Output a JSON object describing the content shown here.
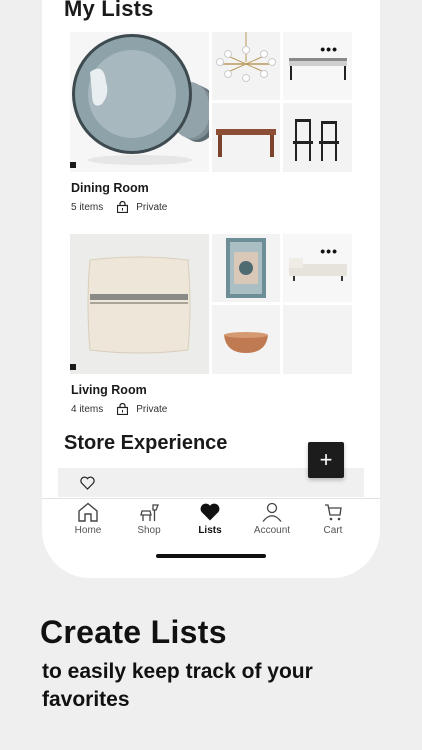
{
  "lists_heading": "My Lists",
  "lists": [
    {
      "title": "Dining Room",
      "count": "5 items",
      "privacy": "Private",
      "more": "•••"
    },
    {
      "title": "Living Room",
      "count": "4 items",
      "privacy": "Private",
      "more": "•••"
    }
  ],
  "store_section": {
    "title": "Store Experience",
    "add_label": "+"
  },
  "tabs": [
    {
      "label": "Home",
      "icon": "home-icon"
    },
    {
      "label": "Shop",
      "icon": "shop-icon"
    },
    {
      "label": "Lists",
      "icon": "heart-icon",
      "active": true
    },
    {
      "label": "Account",
      "icon": "account-icon"
    },
    {
      "label": "Cart",
      "icon": "cart-icon"
    }
  ],
  "promo": {
    "title": "Create Lists",
    "subtitle": "to easily keep track of your favorites"
  }
}
